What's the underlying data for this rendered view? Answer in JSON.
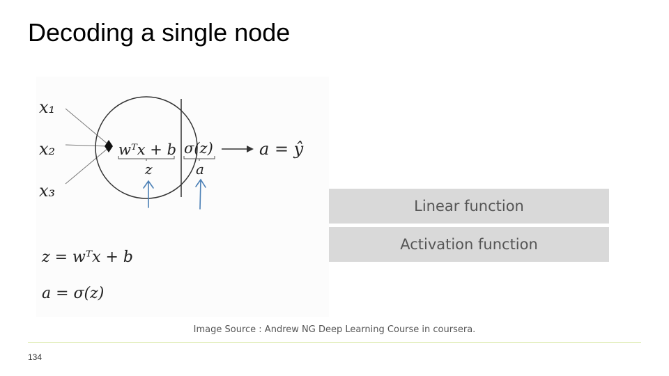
{
  "slide": {
    "title": "Decoding a single node",
    "page_number": "134",
    "source": "Image Source : Andrew NG Deep Learning Course in coursera."
  },
  "diagram": {
    "inputs": [
      "x₁",
      "x₂",
      "x₃"
    ],
    "linear_part": "wᵀx + b",
    "linear_label": "z",
    "activation_part": "σ(z)",
    "activation_label": "a",
    "output": "a = ŷ",
    "eq1": "z = wᵀx + b",
    "eq2": "a = σ(z)"
  },
  "labels": {
    "linear": "Linear function",
    "activation": "Activation function"
  },
  "colors": {
    "arrow_blue": "#4a7fb5",
    "box_gray": "#d9d9d9",
    "footer_line": "#d6e6a0"
  }
}
